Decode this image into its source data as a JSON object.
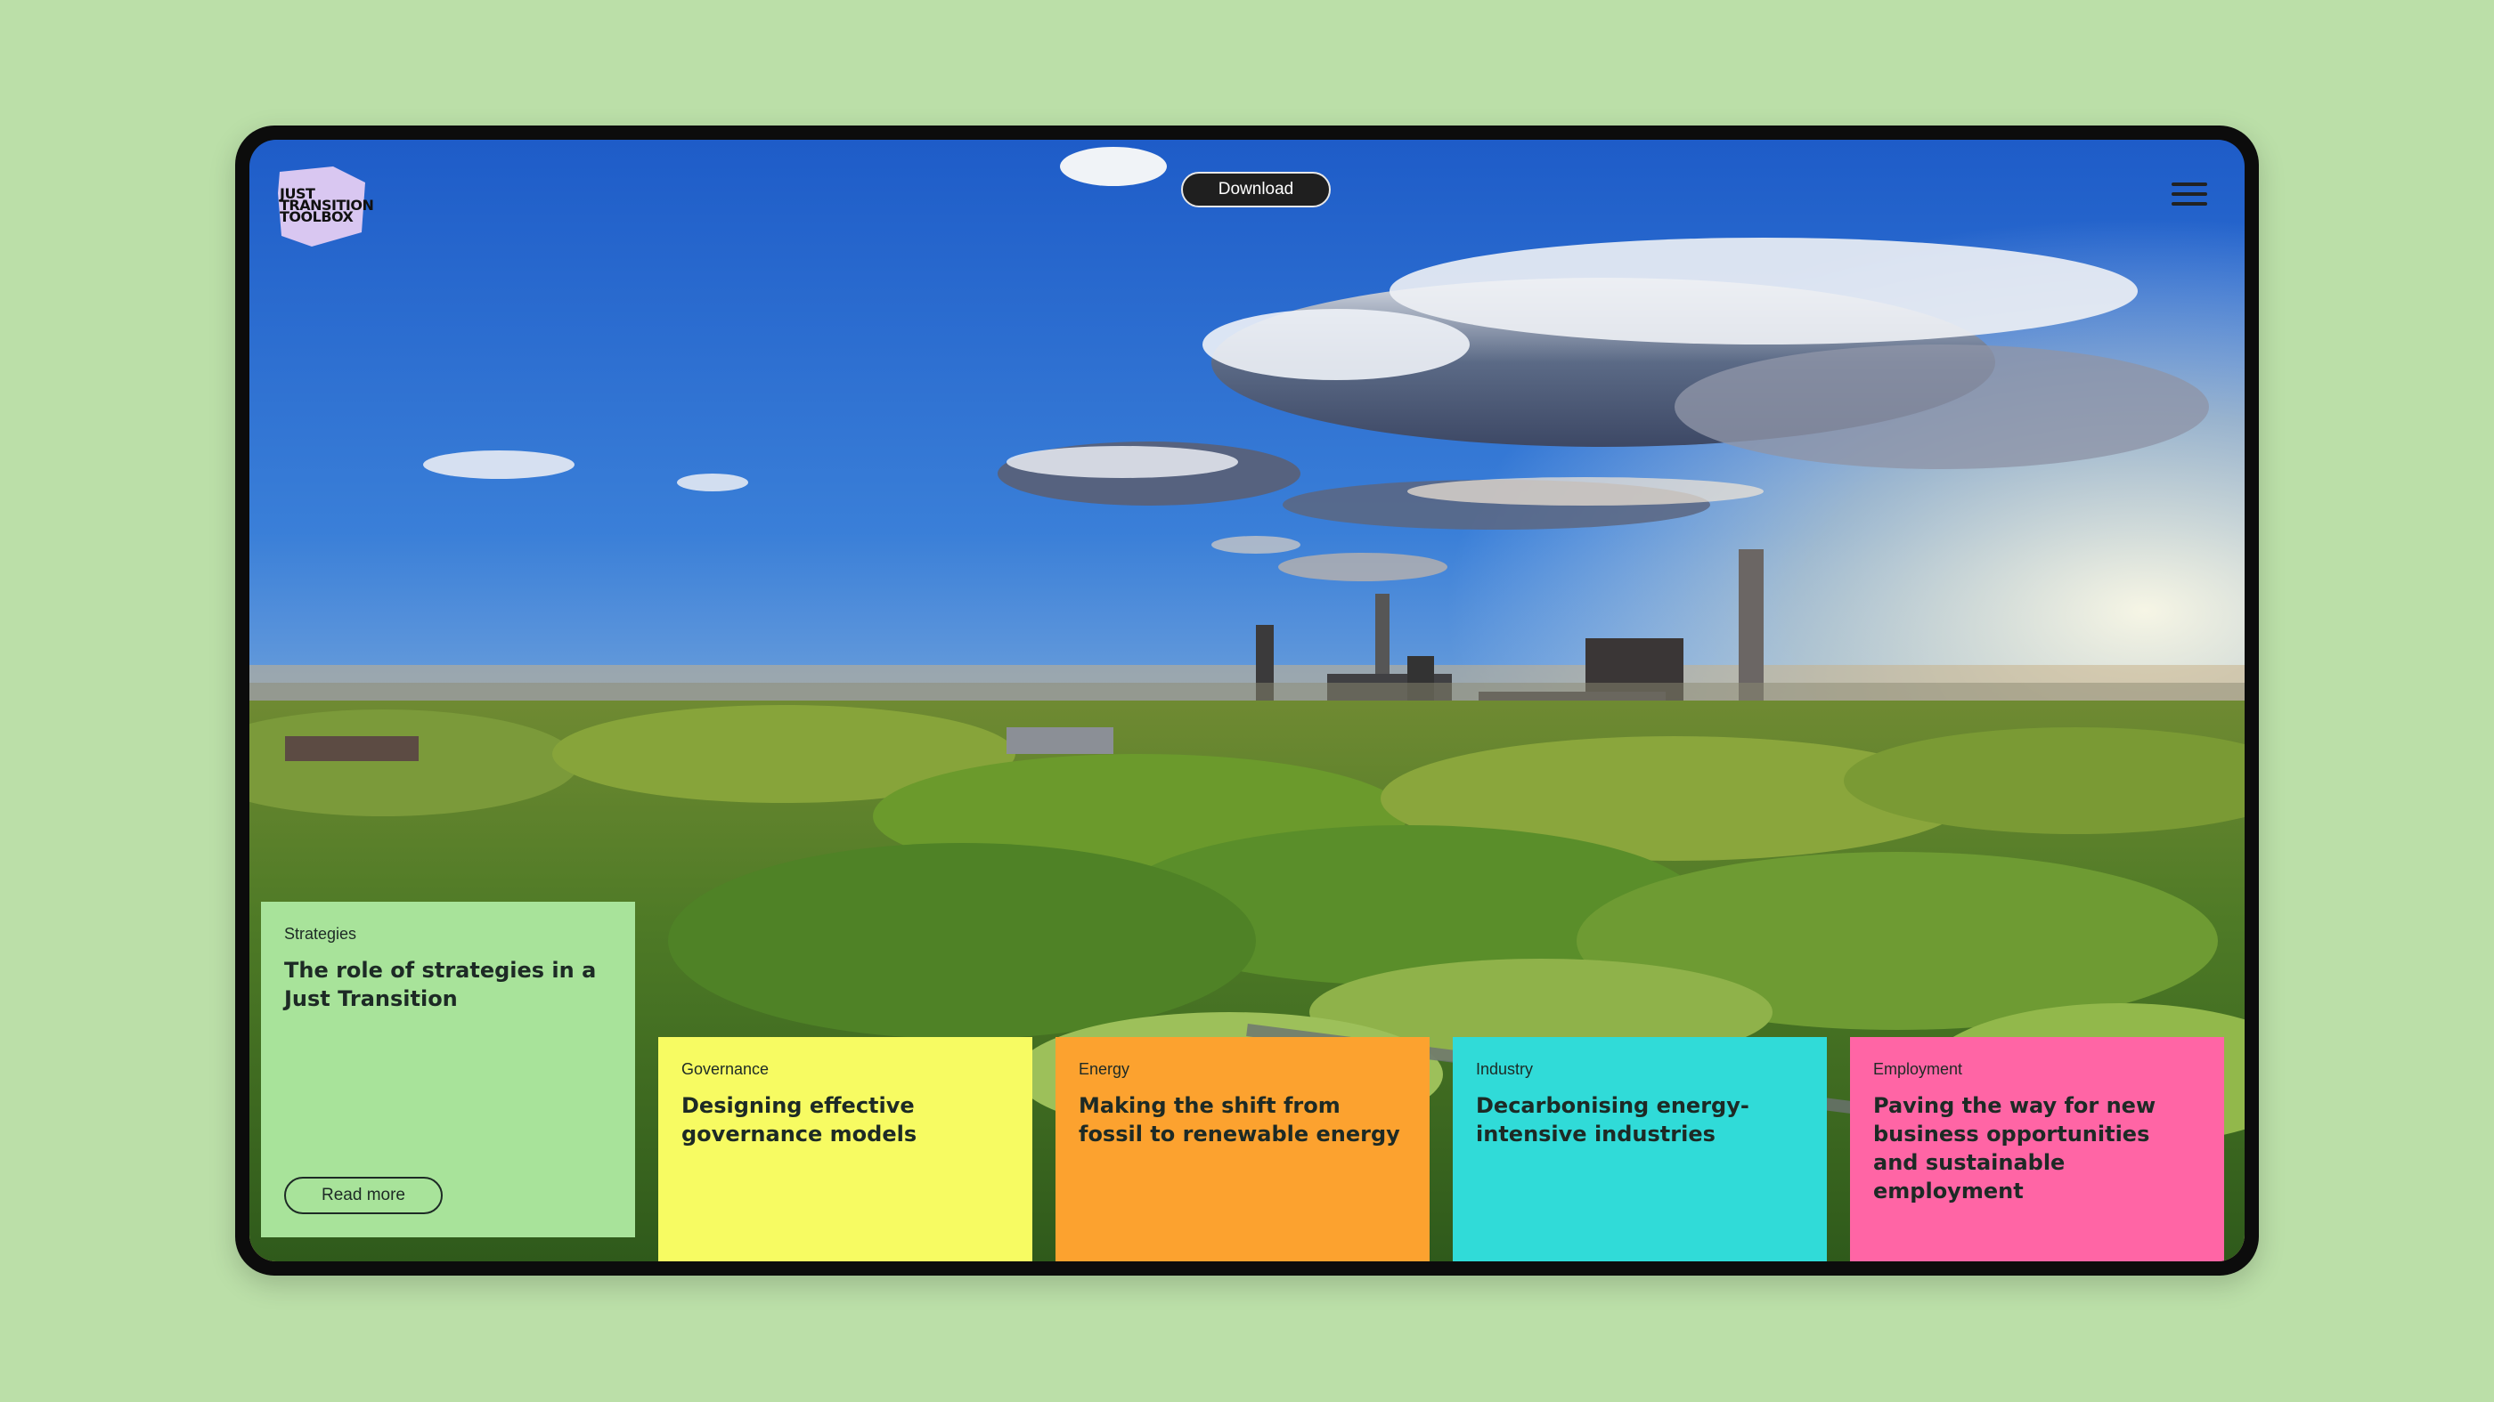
{
  "header": {
    "logo_text": "JUST TRANSITION TOOLBOX",
    "logo_lines": [
      "JUST",
      "TRANSITION",
      "TOOLBOX"
    ],
    "download_label": "Download",
    "menu_icon": "hamburger-menu-icon"
  },
  "colors": {
    "page_background": "#bbdfa8",
    "strategies": "#a8e39a",
    "governance": "#f7fb62",
    "energy": "#fca22f",
    "industry": "#30dbd8",
    "employment": "#ff65a5"
  },
  "cards": [
    {
      "category": "Strategies",
      "title": "The role of strategies in a Just Transition",
      "button": "Read more"
    },
    {
      "category": "Governance",
      "title": "Designing effective governance models"
    },
    {
      "category": "Energy",
      "title": "Making the shift from fossil to renewable energy"
    },
    {
      "category": "Industry",
      "title": "Decarbonising energy-intensive industries"
    },
    {
      "category": "Employment",
      "title": "Paving the way for new business opportunities and sustainable employment"
    }
  ]
}
